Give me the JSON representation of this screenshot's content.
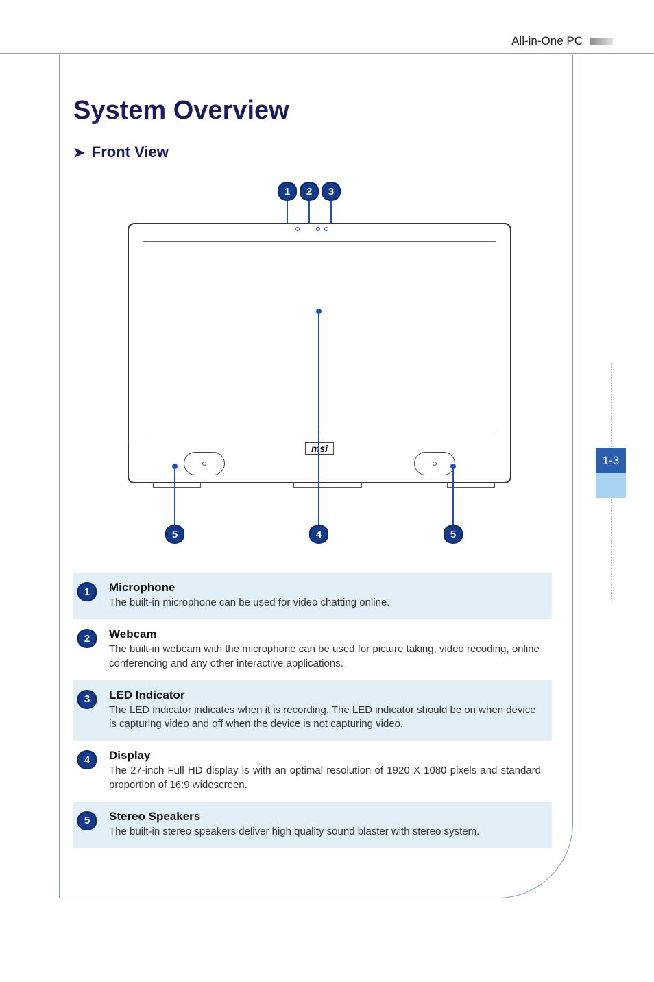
{
  "header": {
    "product_label": "All-in-One PC"
  },
  "page_title": "System Overview",
  "section_title": "Front View",
  "side_tab": "1-3",
  "device_logo": "msi",
  "callouts": {
    "1": "1",
    "2": "2",
    "3": "3",
    "4": "4",
    "5": "5"
  },
  "items": [
    {
      "num": "1",
      "title": "Microphone",
      "desc": "The built-in microphone can be used for video chatting online.",
      "shaded": true,
      "justify": false
    },
    {
      "num": "2",
      "title": "Webcam",
      "desc": "The built-in webcam with the microphone can be used for picture taking, video recoding, online conferencing and any other interactive applications.",
      "shaded": false,
      "justify": false
    },
    {
      "num": "3",
      "title": "LED Indicator",
      "desc": "The LED indicator indicates when it is recording. The LED indicator should be on when device is capturing video and off when the device is not capturing video.",
      "shaded": true,
      "justify": false
    },
    {
      "num": "4",
      "title": "Display",
      "desc": "The 27-inch Full HD display is with an optimal resolution of 1920 X 1080 pixels and standard proportion of 16:9 widescreen.",
      "shaded": false,
      "justify": true
    },
    {
      "num": "5",
      "title": "Stereo Speakers",
      "desc": "The built-in stereo speakers deliver high quality sound blaster with stereo system.",
      "shaded": true,
      "justify": false
    }
  ]
}
